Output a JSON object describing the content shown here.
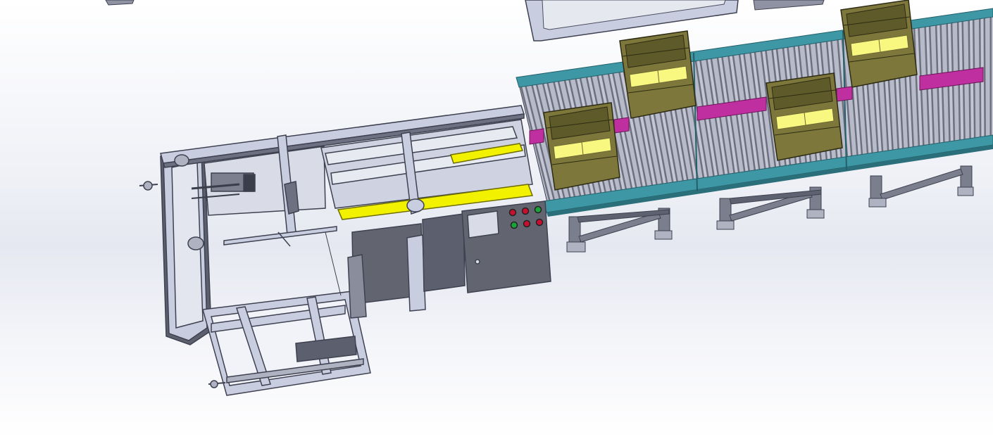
{
  "viewport": {
    "background_top": "#ffffff",
    "background_mid": "#e6e8f1"
  },
  "colors": {
    "frame_steel": "#c9cde0",
    "frame_edge": "#4a4d5e",
    "panel_dark": "#5c5f6e",
    "cabinet": "#62656f",
    "guide_yellow": "#f2f200",
    "box_olive": "#7d773b",
    "box_olive_dark": "#5e5a2a",
    "box_label_yellow": "#f8f880",
    "conveyor_rail_teal": "#3d97a5",
    "roller_gray": "#9b9fae",
    "stopper_magenta": "#c02fa0",
    "leg_gray": "#7b7e8c"
  },
  "components": [
    {
      "name": "case-erector-frame"
    },
    {
      "name": "case-opener-arm"
    },
    {
      "name": "flap-folder-guides"
    },
    {
      "name": "control-cabinet",
      "buttons": [
        "red",
        "red",
        "green",
        "green",
        "red",
        "red"
      ]
    },
    {
      "name": "roller-conveyor"
    },
    {
      "name": "carton-box",
      "count": 4
    }
  ]
}
